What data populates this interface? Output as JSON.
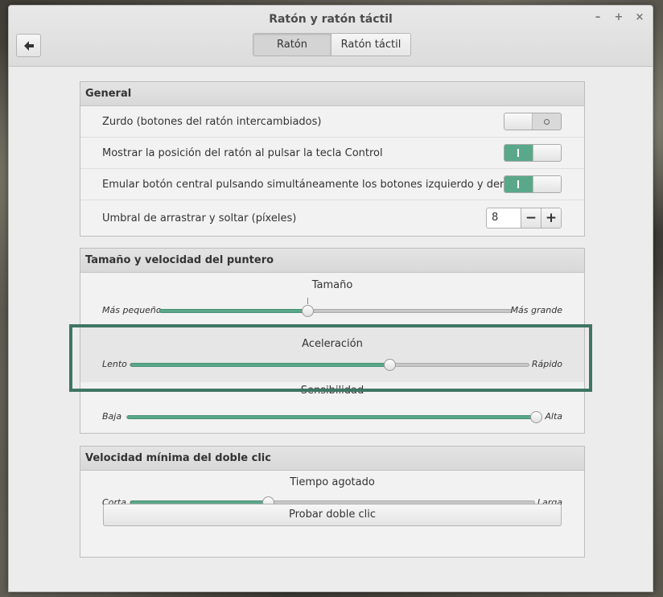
{
  "window": {
    "title": "Ratón y ratón táctil",
    "controls": {
      "minimize": "–",
      "maximize": "+",
      "close": "×"
    },
    "back_icon": "arrow-left-icon",
    "tabs": [
      {
        "label": "Ratón",
        "active": true
      },
      {
        "label": "Ratón táctil",
        "active": false
      }
    ]
  },
  "general": {
    "header": "General",
    "rows": [
      {
        "label": "Zurdo (botones del ratón intercambiados)",
        "type": "toggle",
        "value": false
      },
      {
        "label": "Mostrar la posición del ratón al pulsar la tecla Control",
        "type": "toggle",
        "value": true
      },
      {
        "label": "Emular botón central pulsando simultáneamente los botones izquierdo y derecho",
        "type": "toggle",
        "value": true
      },
      {
        "label": "Umbral de arrastrar y soltar (píxeles)",
        "type": "spin",
        "value": "8",
        "minus": "−",
        "plus": "+"
      }
    ]
  },
  "pointer": {
    "header": "Tamaño y velocidad del puntero",
    "size": {
      "title": "Tamaño",
      "min_label": "Más pequeño",
      "max_label": "Más grande",
      "value": 0.42
    },
    "acceleration": {
      "title": "Aceleración",
      "min_label": "Lento",
      "max_label": "Rápido",
      "value": 0.65
    },
    "sensitivity": {
      "title": "Sensibilidad",
      "min_label": "Baja",
      "max_label": "Alta",
      "value": 1.0
    }
  },
  "double_click": {
    "header": "Velocidad mínima del doble clic",
    "timeout": {
      "title": "Tiempo agotado",
      "min_label": "Corta",
      "max_label": "Larga",
      "value": 0.34
    },
    "test_button": "Probar doble clic"
  },
  "colors": {
    "accent": "#5aa88a",
    "highlight_outline": "#3f7563"
  }
}
